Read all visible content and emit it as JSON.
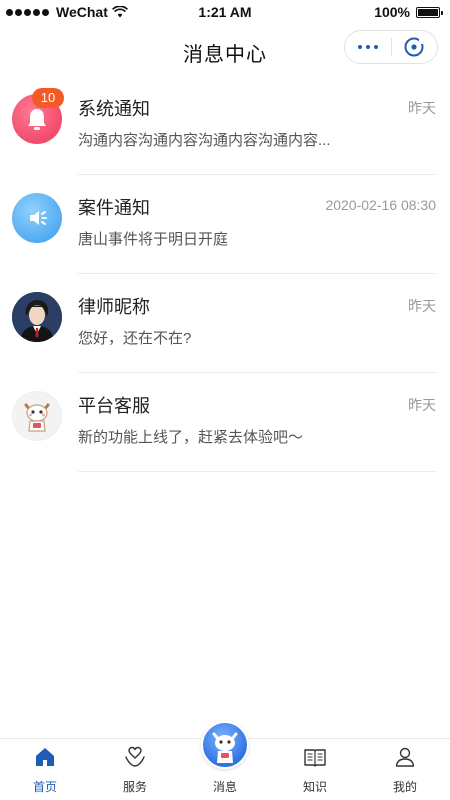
{
  "status_bar": {
    "carrier": "WeChat",
    "time": "1:21 AM",
    "battery": "100%"
  },
  "nav": {
    "title": "消息中心"
  },
  "messages": [
    {
      "name": "系统通知",
      "time": "昨天",
      "preview": "沟通内容沟通内容沟通内容沟通内容...",
      "badge": "10",
      "icon": "bell-icon"
    },
    {
      "name": "案件通知",
      "time": "2020-02-16 08:30",
      "preview": "唐山事件将于明日开庭",
      "icon": "speaker-icon"
    },
    {
      "name": "律师昵称",
      "time": "昨天",
      "preview": "您好，还在不在?",
      "icon": "lawyer-avatar"
    },
    {
      "name": "平台客服",
      "time": "昨天",
      "preview": "新的功能上线了，赶紧去体验吧～",
      "icon": "mascot-avatar"
    }
  ],
  "tabbar": {
    "items": [
      {
        "label": "首页",
        "icon": "home-icon",
        "active": true
      },
      {
        "label": "服务",
        "icon": "heart-hand-icon"
      },
      {
        "label": "消息",
        "icon": "mascot-icon"
      },
      {
        "label": "知识",
        "icon": "book-icon"
      },
      {
        "label": "我的",
        "icon": "user-icon"
      }
    ]
  },
  "colors": {
    "accent": "#1d5db5",
    "badge": "#f35a25",
    "system_icon_bg": "#f24b6c",
    "case_icon_bg": "#4fa9f0",
    "muted_text": "#9a9a9a"
  }
}
